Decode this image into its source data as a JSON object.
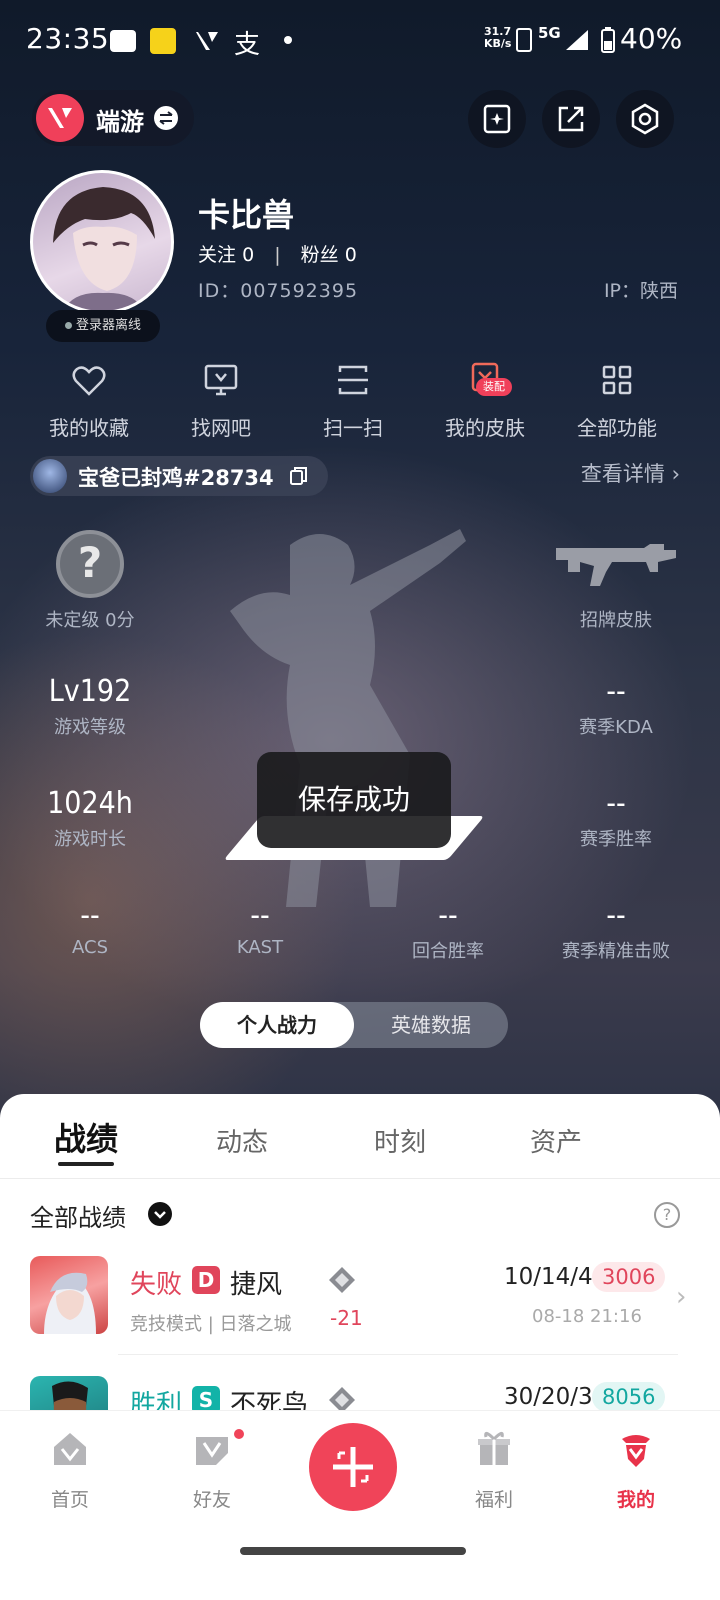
{
  "status_bar": {
    "time": "23:35",
    "net_speed": "31.7\nKB/s",
    "network": "5G",
    "battery": "40%"
  },
  "header": {
    "mode": "端游"
  },
  "profile": {
    "nickname": "卡比兽",
    "follow_label": "关注",
    "follow_count": "0",
    "fans_label": "粉丝",
    "fans_count": "0",
    "id": "ID：007592395",
    "ip": "IP：陕西",
    "status": "登录器离线"
  },
  "quick_functions": [
    {
      "label": "我的收藏",
      "icon": "heart-icon"
    },
    {
      "label": "找网吧",
      "icon": "monitor-icon"
    },
    {
      "label": "扫一扫",
      "icon": "scan-icon"
    },
    {
      "label": "我的皮肤",
      "icon": "skin-icon",
      "badge": "装配"
    },
    {
      "label": "全部功能",
      "icon": "grid-icon"
    }
  ],
  "account": {
    "name": "宝爸已封鸡#28734",
    "detail_link": "查看详情 ›"
  },
  "stats": {
    "rank": {
      "icon_text": "?",
      "label": "未定级 0分"
    },
    "skin": {
      "label": "招牌皮肤"
    },
    "level": {
      "value": "Lv192",
      "label": "游戏等级"
    },
    "kda": {
      "value": "--",
      "label": "赛季KDA"
    },
    "playtime": {
      "value": "1024h",
      "label": "游戏时长"
    },
    "winrate": {
      "value": "--",
      "label": "赛季胜率"
    },
    "acs": {
      "value": "--",
      "label": "ACS"
    },
    "kast": {
      "value": "--",
      "label": "KAST"
    },
    "round_win": {
      "value": "--",
      "label": "回合胜率"
    },
    "headshot": {
      "value": "--",
      "label": "赛季精准击败"
    }
  },
  "toast": "保存成功",
  "segment": {
    "active": "个人战力",
    "inactive": "英雄数据"
  },
  "tabs": [
    "战绩",
    "动态",
    "时刻",
    "资产"
  ],
  "filter": {
    "label": "全部战绩",
    "help": "?"
  },
  "matches": [
    {
      "result": "失败",
      "result_color": "#e0455b",
      "grade": "D",
      "grade_color": "#e0455b",
      "agent": "捷风",
      "sub": "竞技模式 | 日落之城",
      "delta": "-21",
      "kda": "10/14/4",
      "score": "3006",
      "score_color": "#e0455b",
      "score_bg": "#fde8ea",
      "date": "08-18 21:16"
    },
    {
      "result": "胜利",
      "result_color": "#12a7a0",
      "grade": "S",
      "grade_color": "#12b3a8",
      "agent": "不死鸟",
      "sub": "",
      "delta": "",
      "kda": "30/20/3",
      "score": "8056",
      "score_color": "#12a7a0",
      "score_bg": "#e2f6f4",
      "date": ""
    }
  ],
  "nav": [
    {
      "label": "首页",
      "icon": "home-icon"
    },
    {
      "label": "好友",
      "icon": "friends-icon"
    },
    {
      "label": "福利",
      "icon": "gift-icon"
    },
    {
      "label": "我的",
      "icon": "profile-icon"
    }
  ],
  "colors": {
    "accent": "#f04459",
    "panel": "#ffffff"
  }
}
